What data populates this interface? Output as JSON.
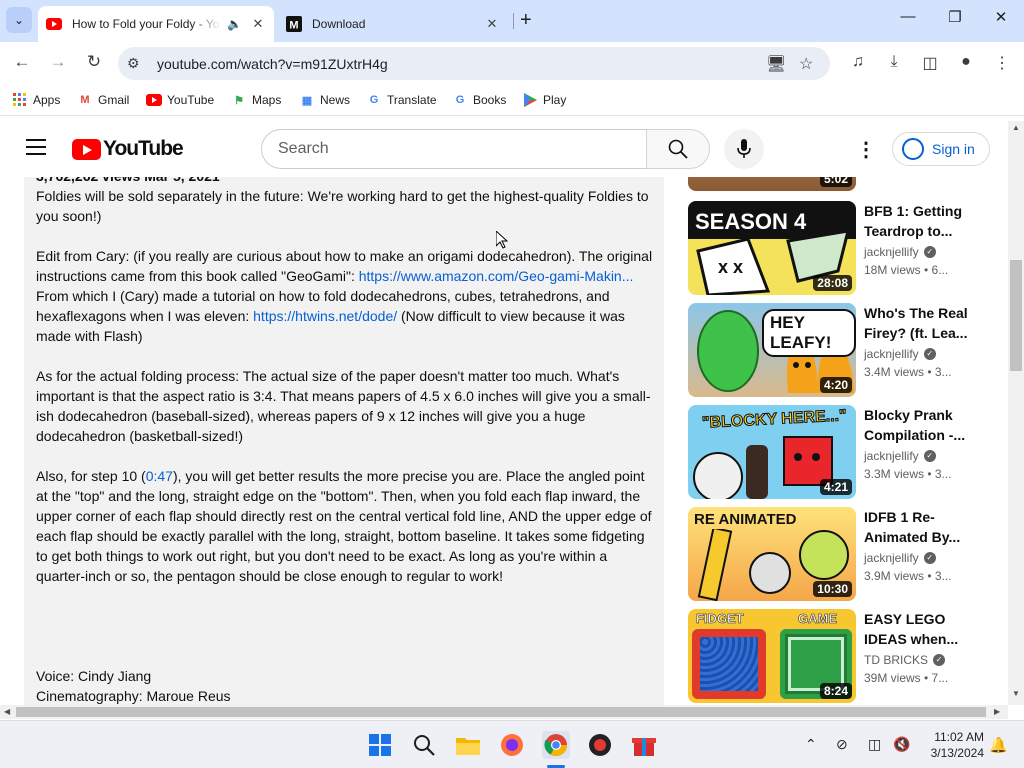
{
  "browser": {
    "tabs": [
      {
        "title": "How to Fold your Foldy - Yo",
        "active": true,
        "favicon": "youtube-icon"
      },
      {
        "title": "Download",
        "active": false,
        "favicon": "m-logo-icon"
      }
    ],
    "url": "youtube.com/watch?v=m91ZUxtrH4g",
    "bookmarks": [
      "Apps",
      "Gmail",
      "YouTube",
      "Maps",
      "News",
      "Translate",
      "Books",
      "Play"
    ]
  },
  "youtube": {
    "logo_text": "YouTube",
    "search_placeholder": "Search",
    "sign_in": "Sign in"
  },
  "description": {
    "header_fragment": "3,762,262 views  Mar 5, 2021",
    "p1": "Foldies will be sold separately in the future: We're working hard to get the highest-quality Foldies to you soon!)",
    "p2_a": "Edit from Cary: (if you really are curious about how to make an origami dodecahedron). The original instructions came from this book called \"GeoGami\": ",
    "p2_link1": "https://www.amazon.com/Geo-gami-Makin...",
    "p2_b": " From which I (Cary) made a tutorial on how to fold dodecahedrons, cubes, tetrahedrons, and hexaflexagons when I was eleven: ",
    "p2_link2": "https://htwins.net/dode/",
    "p2_c": " (Now difficult to view because it was made with Flash)",
    "p3": "As for the actual folding process: The actual size of the paper doesn't matter too much. What's important is that the aspect ratio is 3:4. That means papers of 4.5 x 6.0 inches will give you a small-ish dodecahedron (baseball-sized), whereas papers of 9 x 12 inches will give you a huge dodecahedron (basketball-sized!)",
    "p4_a": "Also, for step 10 (",
    "p4_time": "0:47",
    "p4_b": "), you will get better results the more precise you are. Place the angled point at the \"top\" and the long, straight edge on the \"bottom\". Then, when you fold each flap inward, the upper corner of each flap should directly rest on the central vertical fold line, AND the upper edge of each flap should be exactly parallel with the long, straight, bottom baseline. It takes some fidgeting to get both things to work out right, but you don't need to be exact. As long as you're within a quarter-inch or so, the pentagon should be close enough to regular to work!",
    "credit1": "Voice: Cindy Jiang",
    "credit2": "Cinematography: Maroue Reus"
  },
  "sidebar": {
    "partial_duration": "5:02",
    "videos": [
      {
        "title": "BFB 1: Getting Teardrop to...",
        "channel": "jacknjellify",
        "meta": "18M views  •  6...",
        "duration": "28:08",
        "thumb_text": "SEASON 4"
      },
      {
        "title": "Who's The Real Firey? (ft. Lea...",
        "channel": "jacknjellify",
        "meta": "3.4M views  •  3...",
        "duration": "4:20",
        "thumb_text": "HEY LEAFY!"
      },
      {
        "title": "Blocky Prank Compilation -...",
        "channel": "jacknjellify",
        "meta": "3.3M views  •  3...",
        "duration": "4:21",
        "thumb_text": "\"BLOCKY HERE...\""
      },
      {
        "title": "IDFB 1 Re-Animated By...",
        "channel": "jacknjellify",
        "meta": "3.9M views  •  3...",
        "duration": "10:30",
        "thumb_text": "RE ANIMATED"
      },
      {
        "title": "EASY LEGO IDEAS when...",
        "channel": "TD BRICKS",
        "meta": "39M views  •  7...",
        "duration": "8:24",
        "thumb_text_left": "FIDGET",
        "thumb_text_right": "GAME"
      }
    ]
  },
  "taskbar": {
    "time": "11:02 AM",
    "date": "3/13/2024"
  },
  "colors": {
    "tabstrip": "#d3e3fd",
    "link": "#065fd4",
    "yt_red": "#ff0000",
    "desc_bg": "#f2f2f2"
  }
}
